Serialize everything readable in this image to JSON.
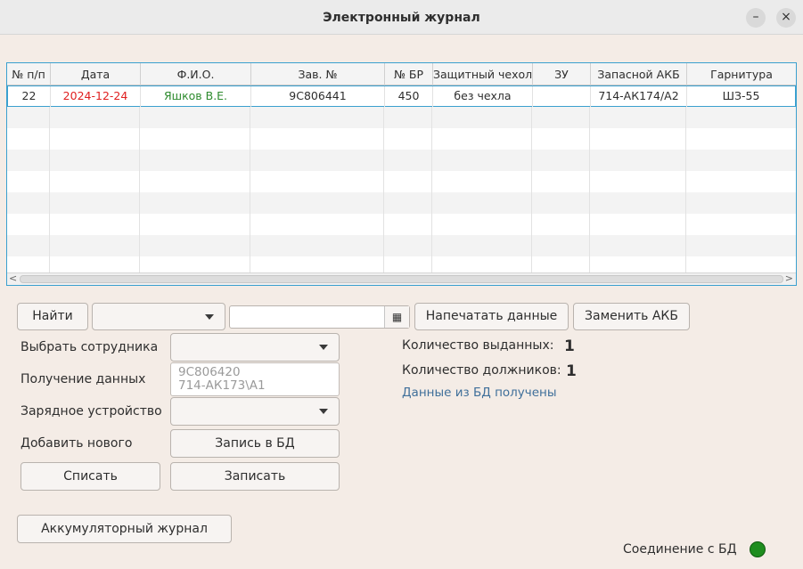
{
  "window": {
    "title": "Электронный журнал",
    "minimize_glyph": "–",
    "close_glyph": "×"
  },
  "table": {
    "columns": [
      "№ п/п",
      "Дата",
      "Ф.И.О.",
      "Зав. №",
      "№ БР",
      "Защитный чехол",
      "ЗУ",
      "Запасной АКБ",
      "Гарнитура"
    ],
    "rows": [
      [
        "22",
        "2024-12-24",
        "Яшков В.Е.",
        "9С806441",
        "450",
        "без чехла",
        "",
        "714-АК174/А2",
        "ШЗ-55"
      ]
    ],
    "date_color": "#e02020",
    "name_color": "#2e8b2e",
    "scroll_left": "<",
    "scroll_right": ">"
  },
  "toolbar": {
    "find_label": "Найти",
    "search_combo_value": "",
    "date_field_value": "",
    "calendar_icon": "calendar-icon",
    "print_label": "Напечатать данные",
    "replace_battery_label": "Заменить АКБ"
  },
  "form": {
    "select_employee_label": "Выбрать сотрудника",
    "select_employee_value": "",
    "receive_data_label": "Получение данных",
    "received_lines": [
      "9С806420",
      "714-АК173\\А1"
    ],
    "charger_label": "Зарядное устройство",
    "charger_value": "",
    "add_new_label": "Добавить нового",
    "write_db_label": "Запись в БД",
    "write_off_label": "Списать",
    "save_label": "Записать",
    "battery_journal_label": "Аккумуляторный журнал"
  },
  "stats": {
    "issued_label": "Количество выданных:",
    "issued_value": "1",
    "debtors_label": "Количество должников:",
    "debtors_value": "1",
    "db_status": "Данные из БД получены"
  },
  "connection": {
    "label": "Соединение с БД",
    "status_color": "#1f8d1f"
  }
}
